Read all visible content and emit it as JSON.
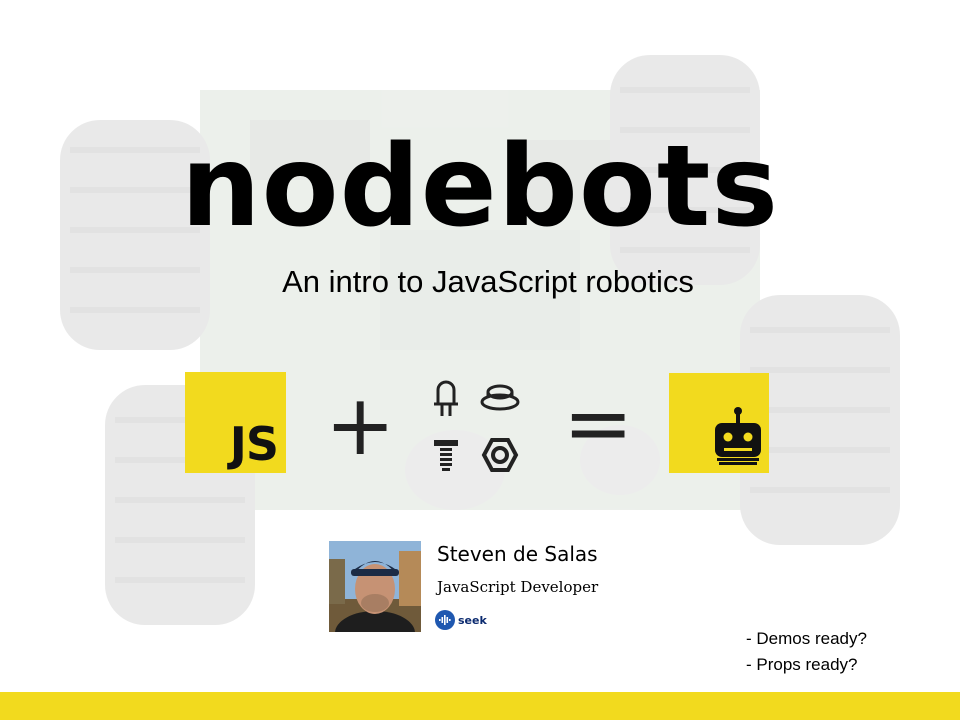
{
  "slide": {
    "title": "nodebots",
    "subtitle": "An intro to JavaScript robotics",
    "equation": {
      "js_label": "JS",
      "plus": "+",
      "equals": "=",
      "parts_icons": [
        "led-icon",
        "button-icon",
        "screw-icon",
        "hex-nut-icon"
      ],
      "result_icon": "robot-icon"
    },
    "speaker": {
      "name": "Steven de Salas",
      "role": "JavaScript Developer",
      "company": "seek"
    },
    "notes": [
      "- Demos ready?",
      "- Props ready?"
    ]
  },
  "colors": {
    "accent": "#f2da1e",
    "text": "#000000",
    "seek_blue": "#1f58b0"
  }
}
